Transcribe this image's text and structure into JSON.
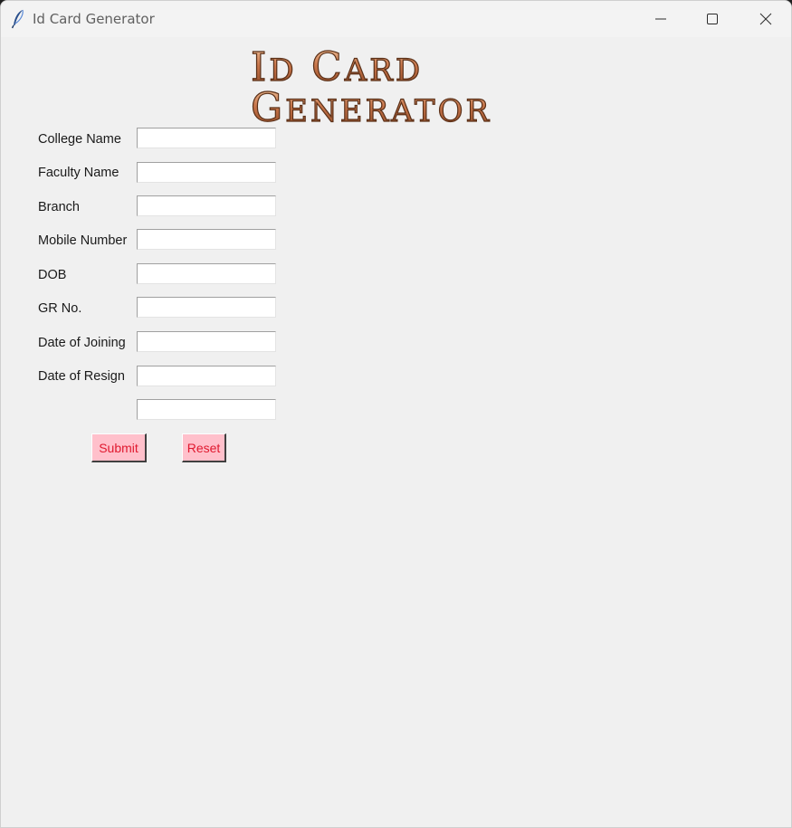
{
  "window": {
    "title": "Id Card Generator",
    "controls": [
      "minimize-icon",
      "maximize-icon",
      "close-icon"
    ]
  },
  "banner": {
    "line1": "ID Card",
    "line2": "Generator",
    "fill_color": "#c8764b",
    "outline_color": "#5a3018"
  },
  "form": {
    "fields": [
      {
        "label": "College Name",
        "value": ""
      },
      {
        "label": "Faculty Name",
        "value": ""
      },
      {
        "label": "Branch",
        "value": ""
      },
      {
        "label": "Mobile Number",
        "value": ""
      },
      {
        "label": "DOB",
        "value": ""
      },
      {
        "label": "GR No.",
        "value": ""
      },
      {
        "label": "Date of Joining",
        "value": ""
      },
      {
        "label": "Date of Resign",
        "value": ""
      },
      {
        "label": "",
        "value": ""
      }
    ]
  },
  "buttons": {
    "submit_label": "Submit",
    "reset_label": "Reset",
    "background_color": "#ffc0cb",
    "text_color": "#e0192f"
  }
}
